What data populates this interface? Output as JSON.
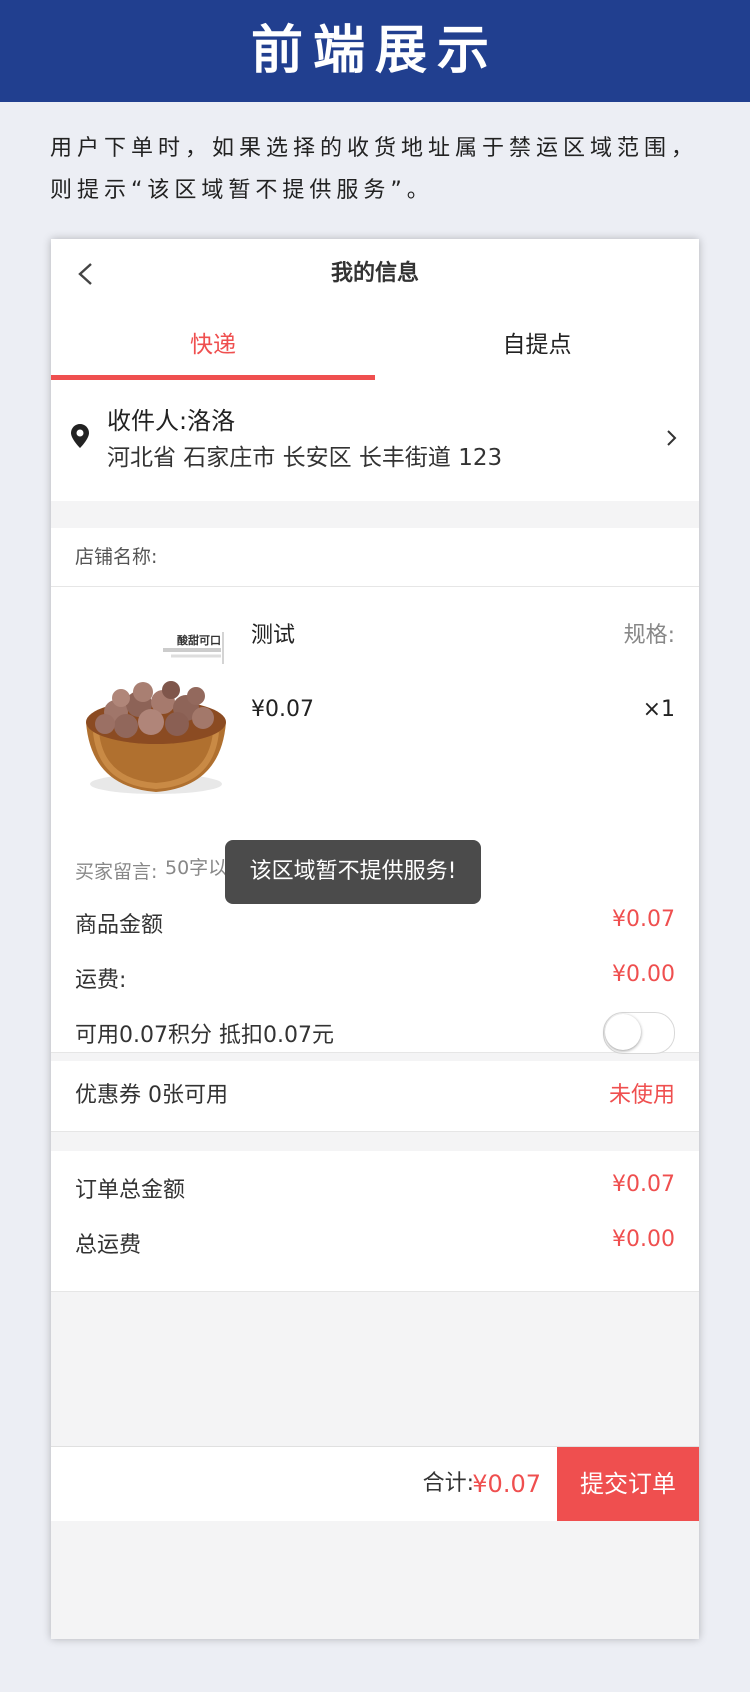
{
  "banner": {
    "title": "前端展示"
  },
  "description": "用户下单时，如果选择的收货地址属于禁运区域范围，则提示“该区域暂不提供服务”。",
  "screen": {
    "nav": {
      "title": "我的信息",
      "back_icon": "chevron-left-icon"
    },
    "tabs": [
      {
        "label": "快递",
        "active": true
      },
      {
        "label": "自提点",
        "active": false
      }
    ],
    "address": {
      "receiver": "收件人:洛洛",
      "line": "河北省 石家庄市 长安区 长丰街道 123"
    },
    "shop": {
      "label": "店铺名称:"
    },
    "product": {
      "image_caption": "酸甜可口",
      "name": "测试",
      "spec_label": "规格:",
      "price": "¥0.07",
      "quantity": "×1"
    },
    "note": {
      "label": "买家留言:",
      "placeholder": "50字以内（选填）"
    },
    "amounts": {
      "goods_label": "商品金额",
      "goods_value": "¥0.07",
      "shipping_label": "运费:",
      "shipping_value": "¥0.00",
      "points_label": "可用0.07积分 抵扣0.07元",
      "points_toggle_on": false
    },
    "toast": "该区域暂不提供服务!",
    "coupon": {
      "label": "优惠券 0张可用",
      "status": "未使用"
    },
    "totals": {
      "order_total_label": "订单总金额",
      "order_total_value": "¥0.07",
      "total_shipping_label": "总运费",
      "total_shipping_value": "¥0.00"
    },
    "footer": {
      "total_label": "合计:",
      "total_value": "¥0.07",
      "submit_label": "提交订单"
    },
    "colors": {
      "accent": "#ef4f4f",
      "banner": "#213f8f"
    }
  }
}
